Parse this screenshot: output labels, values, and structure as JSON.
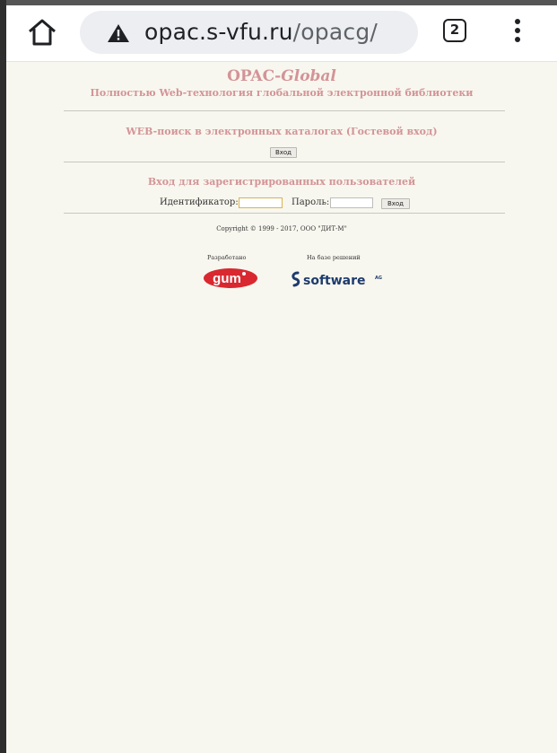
{
  "browser": {
    "url_domain": "opac.s-vfu.ru",
    "url_path": "/opacg/",
    "tab_count": "2",
    "icons": [
      "home-icon",
      "warning-icon",
      "tabs-icon",
      "more-menu-icon"
    ]
  },
  "header": {
    "title_plain": "OPAC-",
    "title_italic": "Global",
    "subtitle": "Полностью Web-технология глобальной электронной библиотеки"
  },
  "guest": {
    "heading": "WEB-поиск в электронных каталогах (Гостевой вход)",
    "button_label": "Вход"
  },
  "registered": {
    "heading": "Вход для зарегистрированных пользователей",
    "id_label": "Идентификатор:",
    "id_value": "",
    "password_label": "Пароль:",
    "password_value": "",
    "button_label": "Вход"
  },
  "footer": {
    "copyright": "Copyright © 1999 - 2017, ООО \"ДИТ-М\"",
    "developed_label": "Разработано",
    "based_on_label": "На базе решений",
    "developer_logo_text": "gum",
    "vendor_logo_text": "software",
    "vendor_logo_suffix": "AG"
  },
  "colors": {
    "accent": "#d39497",
    "page_bg": "#f8f7ef",
    "logo_red": "#d9282f",
    "logo_blue": "#1d3b6d"
  }
}
